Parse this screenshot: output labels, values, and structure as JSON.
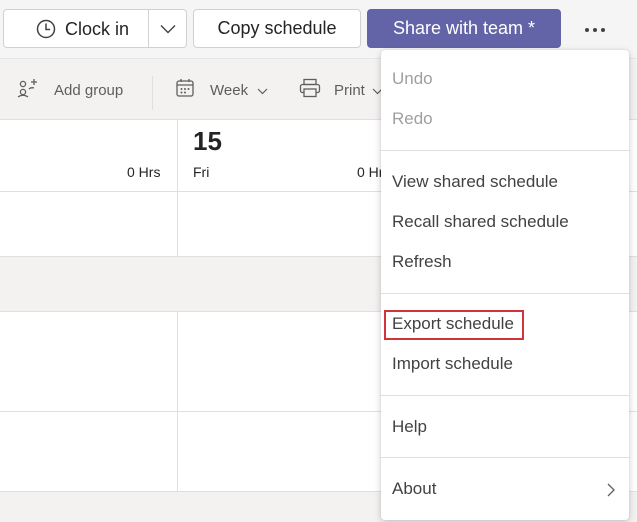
{
  "toolbar": {
    "clock_in_label": "Clock in",
    "copy_schedule_label": "Copy schedule",
    "share_label": "Share with team *",
    "share_color": "#6264a7"
  },
  "subbar": {
    "add_group_label": "Add group",
    "week_label": "Week",
    "print_label": "Print"
  },
  "grid": {
    "day_number": "15",
    "day_name": "Fri",
    "hours_col1": "0 Hrs",
    "hours_col2": "0 Hrs"
  },
  "menu": {
    "undo": "Undo",
    "redo": "Redo",
    "view_shared": "View shared schedule",
    "recall_shared": "Recall shared schedule",
    "refresh": "Refresh",
    "export": "Export schedule",
    "import": "Import schedule",
    "help": "Help",
    "about": "About",
    "highlight_color": "#d13438"
  },
  "icons": [
    "clock-icon",
    "chevron-down-icon",
    "more-options-icon",
    "add-group-icon",
    "calendar-icon",
    "printer-icon",
    "chevron-right-icon"
  ]
}
